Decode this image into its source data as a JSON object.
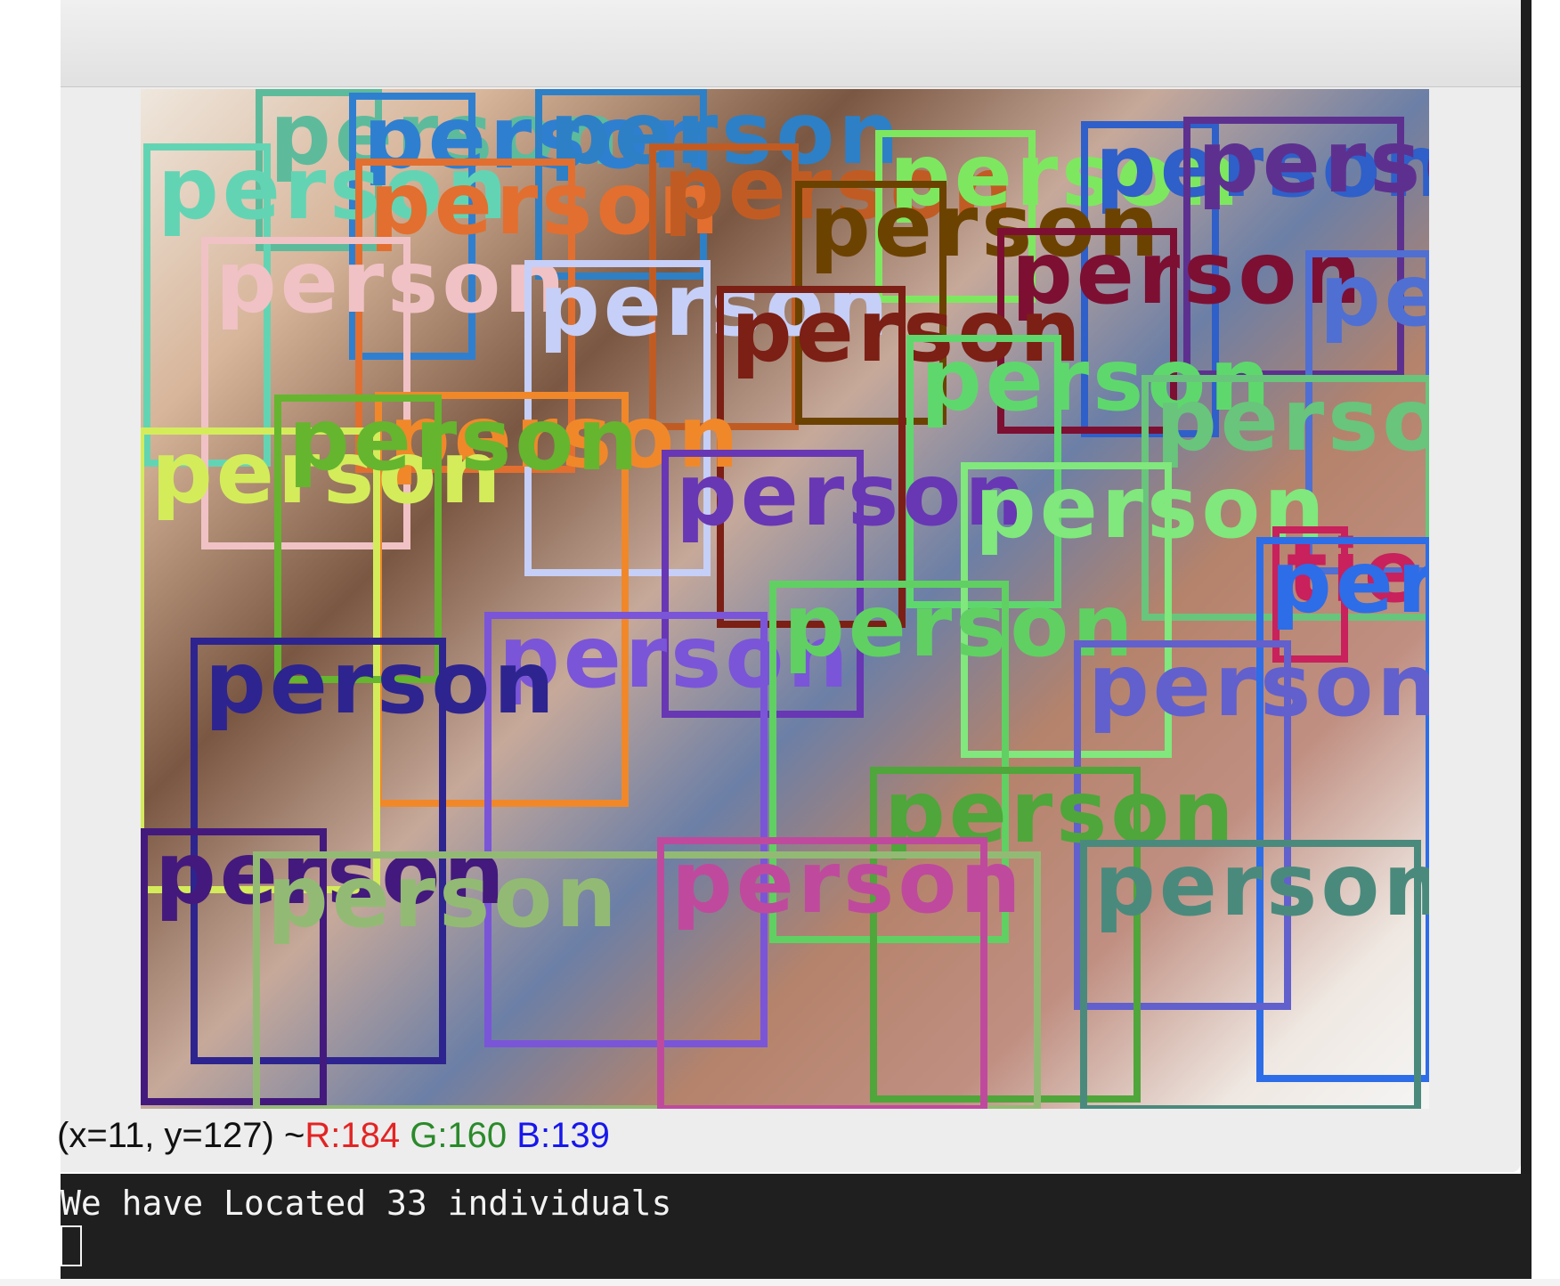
{
  "window": {
    "detections": [
      {
        "label": "person",
        "color": "#5dbb9c"
      },
      {
        "label": "person",
        "color": "#2f7fd0"
      },
      {
        "label": "person",
        "color": "#2d80c6"
      },
      {
        "label": "person",
        "color": "#63d4b3"
      },
      {
        "label": "person",
        "color": "#e26f2f"
      },
      {
        "label": "person",
        "color": "#f0c2c5"
      },
      {
        "label": "person",
        "color": "#c05c23"
      },
      {
        "label": "person",
        "color": "#7de85f"
      },
      {
        "label": "person",
        "color": "#2f5fc9"
      },
      {
        "label": "person",
        "color": "#5d3090"
      },
      {
        "label": "person",
        "color": "#6c4200"
      },
      {
        "label": "person",
        "color": "#7d0f33"
      },
      {
        "label": "person",
        "color": "#c6cff7"
      },
      {
        "label": "person",
        "color": "#7c1f14"
      },
      {
        "label": "person",
        "color": "#4f6fd2"
      },
      {
        "label": "person",
        "color": "#5ed86c"
      },
      {
        "label": "person",
        "color": "#68c57b"
      },
      {
        "label": "person",
        "color": "#f0882a"
      },
      {
        "label": "person",
        "color": "#d4ec5a"
      },
      {
        "label": "person",
        "color": "#6837b4"
      },
      {
        "label": "person",
        "color": "#80e87c"
      },
      {
        "label": "person",
        "color": "#65b52f"
      },
      {
        "label": "person",
        "color": "#7a55d8"
      },
      {
        "label": "person",
        "color": "#2d2490"
      },
      {
        "label": "person",
        "color": "#60d063"
      },
      {
        "label": "tie",
        "color": "#c8215c"
      },
      {
        "label": "person",
        "color": "#2d6de8"
      },
      {
        "label": "person",
        "color": "#6260cc"
      },
      {
        "label": "person",
        "color": "#4fa63a"
      },
      {
        "label": "person",
        "color": "#44197d"
      },
      {
        "label": "person",
        "color": "#93ba74"
      },
      {
        "label": "person",
        "color": "#bf4a9d"
      },
      {
        "label": "person",
        "color": "#4a8a7d"
      }
    ],
    "status": {
      "coords": "(x=11, y=127) ~ ",
      "r": "R:184",
      "g": "G:160",
      "b": "B:139"
    }
  },
  "terminal": {
    "line": "We have Located 33 individuals"
  }
}
